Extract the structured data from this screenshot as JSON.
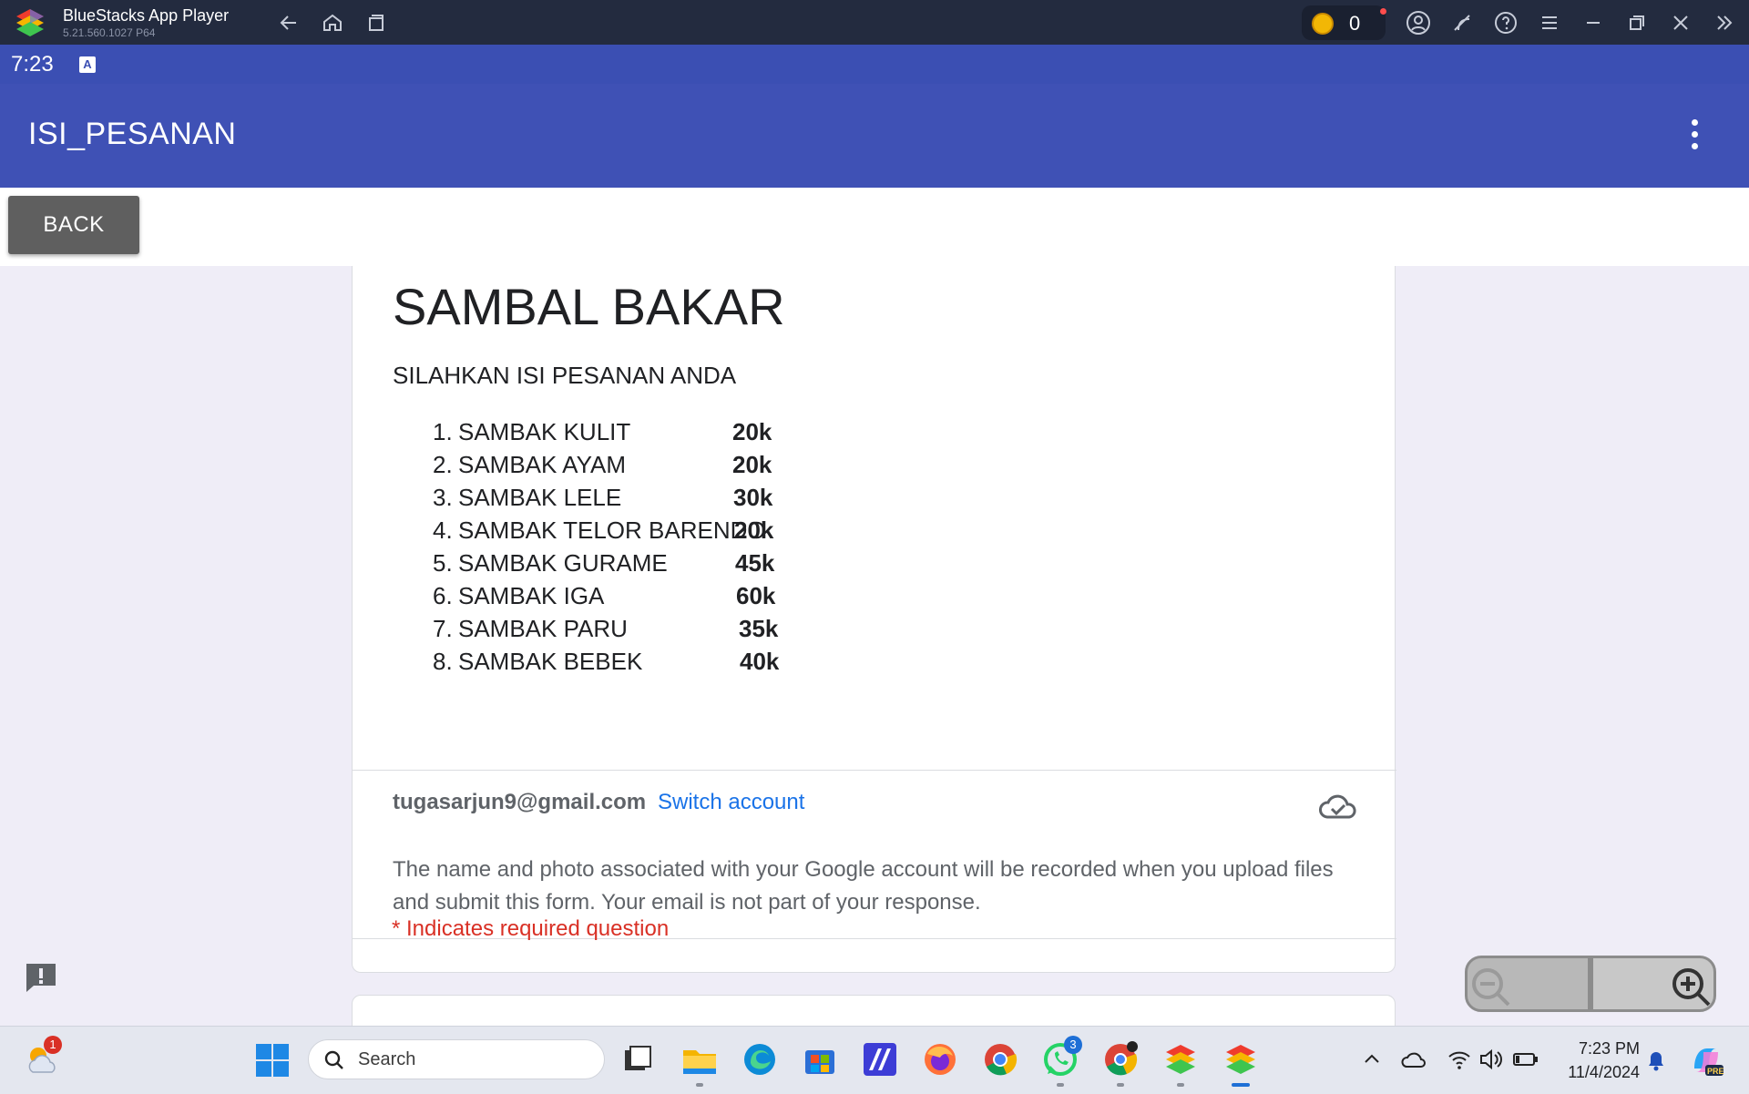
{
  "window": {
    "title": "BlueStacks App Player",
    "version": "5.21.560.1027  P64",
    "coins": "0",
    "icons": [
      "back-arrow-icon",
      "home-icon",
      "recent-apps-icon",
      "account-icon",
      "eco-mode-icon",
      "help-icon",
      "menu-icon",
      "minimize-icon",
      "restore-icon",
      "close-icon",
      "collapse-sidebar-icon"
    ]
  },
  "android_status": {
    "time": "7:23",
    "notification_icon": "A"
  },
  "appbar": {
    "title": "ISI_PESANAN"
  },
  "back_button": {
    "label": "BACK"
  },
  "form": {
    "title": "SAMBAL BAKAR",
    "subtitle": "SILAHKAN ISI PESANAN ANDA",
    "menu": [
      {
        "num": "1.",
        "name": "SAMBAK KULIT",
        "price": "20k"
      },
      {
        "num": "2.",
        "name": "SAMBAK AYAM",
        "price": "20k"
      },
      {
        "num": "3.",
        "name": "SAMBAK LELE",
        "price": "30k"
      },
      {
        "num": "4.",
        "name": "SAMBAK TELOR BARENDO",
        "price": "20k"
      },
      {
        "num": "5.",
        "name": "SAMBAK GURAME",
        "price": "45k"
      },
      {
        "num": "6.",
        "name": "SAMBAK IGA",
        "price": "60k"
      },
      {
        "num": "7.",
        "name": "SAMBAK PARU",
        "price": "35k"
      },
      {
        "num": "8.",
        "name": "SAMBAK BEBEK",
        "price": "40k"
      }
    ],
    "account_email": "tugasarjun9@gmail.com",
    "switch_account": "Switch account",
    "privacy_note": "The name and photo associated with your Google account will be recorded when you upload files and submit this form. Your email is not part of your response.",
    "required_note": "* Indicates required question"
  },
  "taskbar": {
    "search_label": "Search",
    "weather_badge": "1",
    "whatsapp_badge": "3",
    "time": "7:23 PM",
    "date": "11/4/2024",
    "copilot_label": "PRE"
  }
}
